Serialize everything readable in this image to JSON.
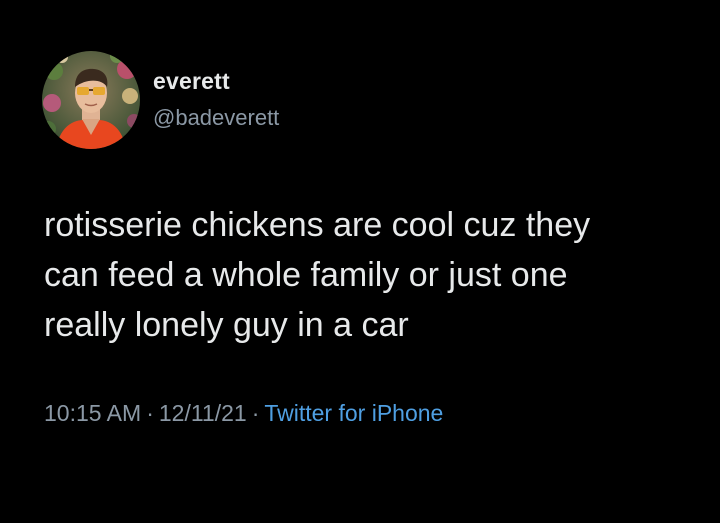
{
  "author": {
    "display_name": "everett",
    "handle": "@badeverett",
    "avatar_icon": "profile-photo-avatar"
  },
  "tweet": {
    "text_lines": [
      "rotisserie chickens are cool cuz they",
      "can feed a whole family or just one",
      "really lonely guy in a car"
    ]
  },
  "meta": {
    "time": "10:15 AM",
    "separator": "·",
    "date": "12/11/21",
    "source": "Twitter for iPhone"
  },
  "colors": {
    "background": "#000000",
    "primary_text": "#e7e9ea",
    "secondary_text": "#8b98a5",
    "link": "#4f9fe2",
    "avatar_shirt": "#e8471f",
    "avatar_background": "#3a6b3c"
  }
}
